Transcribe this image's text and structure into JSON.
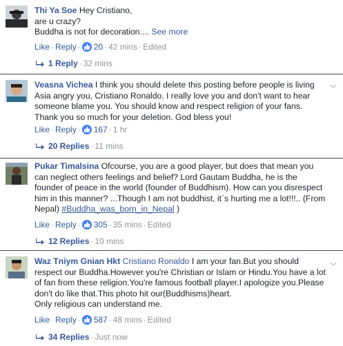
{
  "comments": [
    {
      "author": "Thi Ya Soe",
      "text_lines": [
        "Hey Cristiano,",
        "are u crazy?",
        "Buddha is not for decoration.... "
      ],
      "see_more": "See more",
      "like": "Like",
      "reply": "Reply",
      "likes": "20",
      "time": "42 mins",
      "edited": "Edited",
      "replies": "1 Reply",
      "replies_time": "32 mins"
    },
    {
      "author": "Veasna Vichea",
      "text": "I think you should delete this posting before people is living Asia angry you, Cristiano Ronaldo. I really love you and don't want to hear someone blame you. You should know and respect religion of your fans. Thank you so much for your deletion. God bless you!",
      "like": "Like",
      "reply": "Reply",
      "likes": "167",
      "time": "1 hr",
      "replies": "20 Replies",
      "replies_time": "11 mins"
    },
    {
      "author": "Pukar Timalsina",
      "text": "Ofcourse, you are a good player, but does that mean you can neglect others feelings and belief? Lord Gautam Buddha, he is the founder of peace in the world (founder of Buddhism). How can you disrespect him in this manner? ...Though I am not buddhist, it`s hurting me a lot!!!.. (From Nepal) ",
      "hashtag": "#Buddha_was_born_in_Nepal",
      "text_end": " )",
      "like": "Like",
      "reply": "Reply",
      "likes": "305",
      "time": "35 mins",
      "edited": "Edited",
      "replies": "12 Replies",
      "replies_time": "10 mins"
    },
    {
      "author": "Waz Tniym Gnian Hkt",
      "mention": "Cristiano Ronaldo",
      "text": " I am your fan.But you should respect our Buddha.However you're Christian or Islam or Hindu.You have a lot of fan from these religion.You're famous football player.I apologize you.Please don't do like that.This photo hit our(Buddhisms)heart.",
      "text_line2": "Only religious can understand me.",
      "like": "Like",
      "reply": "Reply",
      "likes": "587",
      "time": "48 mins",
      "edited": "Edited",
      "replies": "34 Replies",
      "replies_time": "Just now"
    }
  ],
  "colors": {
    "link": "#365899",
    "meta": "#90949c",
    "like_badge": "#4080ff",
    "divider": "#4a4a4a"
  },
  "icons": [
    "avatar",
    "like-icon",
    "reply-arrow-icon",
    "chevron-down-icon"
  ]
}
